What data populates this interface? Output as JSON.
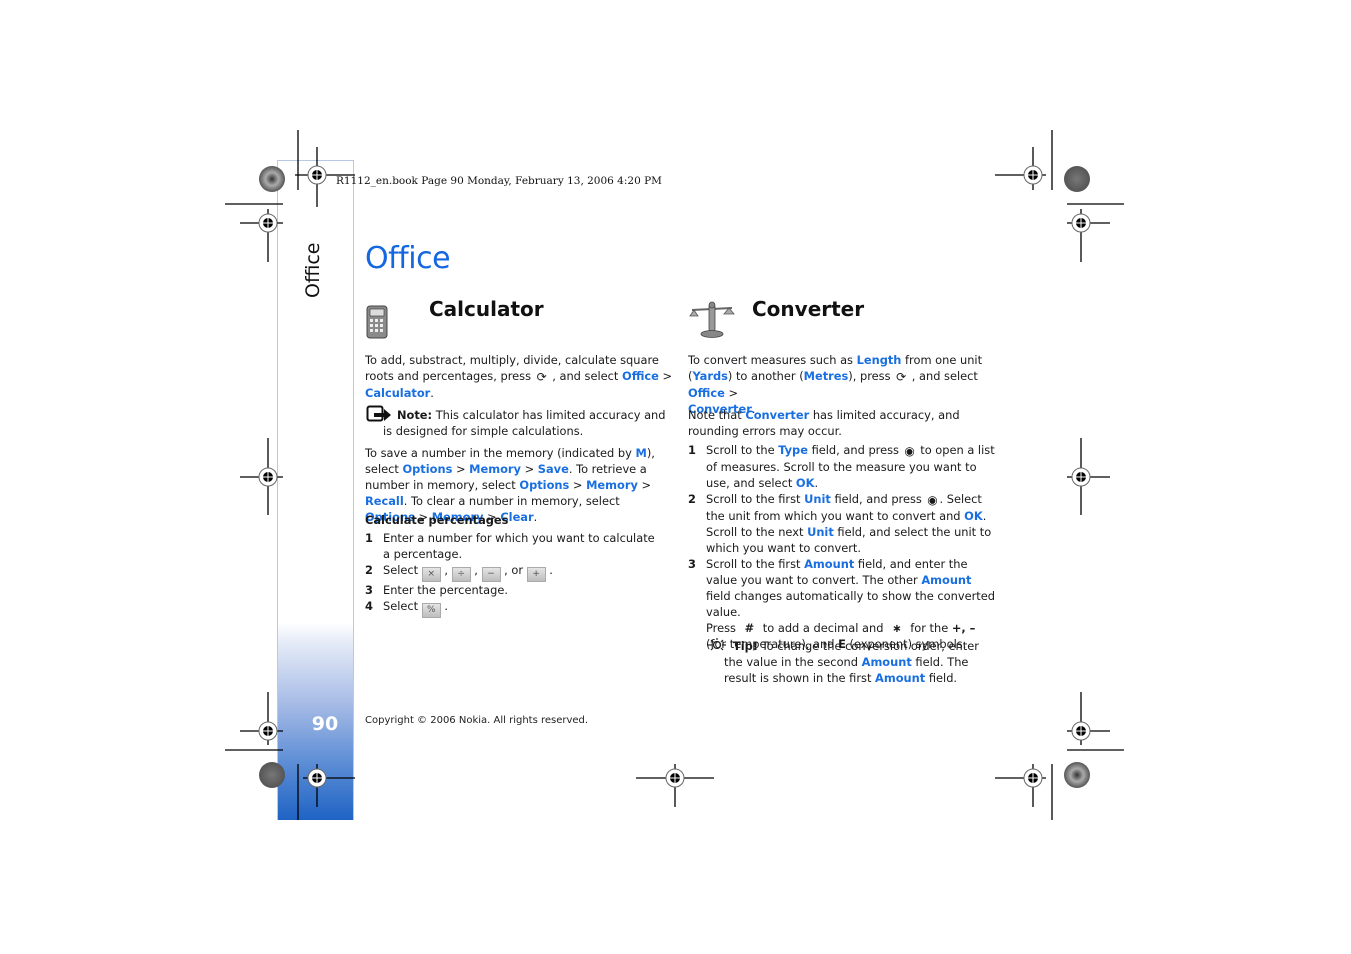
{
  "header": {
    "print_line": "R1112_en.book  Page 90  Monday, February 13, 2006  4:20 PM"
  },
  "sidebar": {
    "section_label": "Office",
    "page_number": "90"
  },
  "page": {
    "title": "Office"
  },
  "calculator": {
    "title": "Calculator",
    "icon": "calculator-icon",
    "intro": {
      "t1": "To add, substract, multiply, divide, calculate square roots and percentages, press ",
      "t2": " , and select ",
      "office": "Office",
      "gt": " >",
      "calculator": "Calculator",
      "end": "."
    },
    "note": {
      "label": "Note:",
      "text": " This calculator has limited accuracy and is designed for simple calculations."
    },
    "memory": {
      "t1": "To save a number in the memory (indicated by ",
      "m": "M",
      "t2": "), select ",
      "options": "Options",
      "memory": "Memory",
      "save": "Save",
      "t3": ". To retrieve a number in memory, select ",
      "recall": "Recall",
      "t4": ". To clear a number in memory, select ",
      "clear": "Clear",
      "sep": " > ",
      "end": "."
    },
    "percent_heading": "Calculate percentages",
    "steps": [
      {
        "n": "1",
        "text": "Enter a number for which you want to calculate a percentage."
      },
      {
        "n": "2",
        "pre": "Select ",
        "keys": [
          "×",
          "÷",
          "−",
          "+"
        ],
        "sep": " , ",
        "or": " , or ",
        "end": " ."
      },
      {
        "n": "3",
        "text": "Enter the percentage."
      },
      {
        "n": "4",
        "pre": "Select ",
        "key": "%",
        "end": " ."
      }
    ]
  },
  "converter": {
    "title": "Converter",
    "icon": "scales-icon",
    "intro": {
      "t1": "To convert measures such as ",
      "length": "Length",
      "t2": " from one unit (",
      "yards": "Yards",
      "t3": ") to another (",
      "metres": "Metres",
      "t4": "), press ",
      "t5": " , and select ",
      "office": "Office",
      "gt": " >",
      "converter": "Converter",
      "end": "."
    },
    "note": {
      "t1": "Note that ",
      "converter": "Converter",
      "t2": " has limited accuracy, and rounding errors may occur."
    },
    "steps": [
      {
        "n": "1",
        "t1": "Scroll to the ",
        "type": "Type",
        "t2": " field, and press ",
        "t3": " to open a list of measures. Scroll to the measure you want to use, and select ",
        "ok": "OK",
        "end": "."
      },
      {
        "n": "2",
        "t1": "Scroll to the first ",
        "unit": "Unit",
        "t2": " field, and press ",
        "t3": ". Select the unit from which you want to convert and ",
        "ok": "OK",
        "t4": ". Scroll to the next ",
        "t5": " field, and select the unit to which you want to convert."
      },
      {
        "n": "3",
        "t1": "Scroll to the first ",
        "amount": "Amount",
        "t2": " field, and enter the value you want to convert. The other ",
        "t3": " field changes automatically to show the converted value.",
        "press": "Press ",
        "hash": "#",
        "t4": " to add a decimal and ",
        "star": "∗",
        "t5": " for the ",
        "plusminus": "+, –",
        "t6": " (for temperature), and ",
        "e": "E",
        "t7": " (exponent) symbols."
      }
    ],
    "tip": {
      "label": "Tip!",
      "t1": " To change the conversion order, enter the value in the second ",
      "amount": "Amount",
      "t2": " field. The result is shown in the first ",
      "t3": " field."
    }
  },
  "footer": {
    "copyright": "Copyright © 2006 Nokia. All rights reserved."
  },
  "colors": {
    "link": "#1a6fe0",
    "title": "#1367e0",
    "sidebar_bottom": "#1f63c4"
  }
}
